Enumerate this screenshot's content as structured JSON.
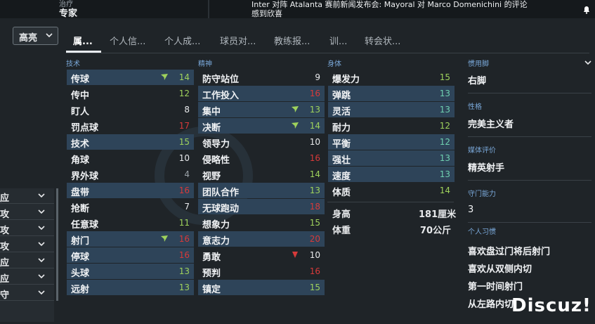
{
  "header": {
    "subtitle": "治疗",
    "role": "专家",
    "news": "Inter 对阵 Atalanta 赛前新闻发布会: Mayoral 对 Marco Domenichini 的评论感到欣喜"
  },
  "view_dropdown": {
    "label": "高亮"
  },
  "tabs": [
    "属...",
    "个人信...",
    "个人成...",
    "球员对...",
    "教练报...",
    "训...",
    "转会状..."
  ],
  "sections": {
    "technical": "技术",
    "mental": "精神",
    "physical": "身体"
  },
  "technical": [
    {
      "name": "传球",
      "value": "14",
      "color": "green",
      "mark": "up"
    },
    {
      "name": "传中",
      "value": "12",
      "color": "green"
    },
    {
      "name": "盯人",
      "value": "8",
      "color": "white"
    },
    {
      "name": "罚点球",
      "value": "17",
      "color": "red"
    },
    {
      "name": "技术",
      "value": "15",
      "color": "green"
    },
    {
      "name": "角球",
      "value": "10",
      "color": "white"
    },
    {
      "name": "界外球",
      "value": "4",
      "color": "grey"
    },
    {
      "name": "盘带",
      "value": "16",
      "color": "red"
    },
    {
      "name": "抢断",
      "value": "7",
      "color": "white"
    },
    {
      "name": "任意球",
      "value": "11",
      "color": "green"
    },
    {
      "name": "射门",
      "value": "16",
      "color": "red",
      "mark": "up"
    },
    {
      "name": "停球",
      "value": "16",
      "color": "red"
    },
    {
      "name": "头球",
      "value": "13",
      "color": "green"
    },
    {
      "name": "远射",
      "value": "13",
      "color": "green"
    }
  ],
  "mental": [
    {
      "name": "防守站位",
      "value": "9",
      "color": "white"
    },
    {
      "name": "工作投入",
      "value": "16",
      "color": "red"
    },
    {
      "name": "集中",
      "value": "13",
      "color": "green",
      "mark": "up"
    },
    {
      "name": "决断",
      "value": "14",
      "color": "green",
      "mark": "up"
    },
    {
      "name": "领导力",
      "value": "10",
      "color": "white"
    },
    {
      "name": "侵略性",
      "value": "16",
      "color": "red"
    },
    {
      "name": "视野",
      "value": "14",
      "color": "green"
    },
    {
      "name": "团队合作",
      "value": "13",
      "color": "green"
    },
    {
      "name": "无球跑动",
      "value": "18",
      "color": "red"
    },
    {
      "name": "想象力",
      "value": "15",
      "color": "green"
    },
    {
      "name": "意志力",
      "value": "20",
      "color": "red"
    },
    {
      "name": "勇敢",
      "value": "10",
      "color": "white",
      "mark": "down"
    },
    {
      "name": "预判",
      "value": "16",
      "color": "red"
    },
    {
      "name": "镇定",
      "value": "15",
      "color": "green"
    }
  ],
  "physical": [
    {
      "name": "爆发力",
      "value": "15",
      "color": "green"
    },
    {
      "name": "弹跳",
      "value": "13",
      "color": "teal"
    },
    {
      "name": "灵活",
      "value": "13",
      "color": "teal"
    },
    {
      "name": "耐力",
      "value": "12",
      "color": "green"
    },
    {
      "name": "平衡",
      "value": "12",
      "color": "teal"
    },
    {
      "name": "强壮",
      "value": "13",
      "color": "teal"
    },
    {
      "name": "速度",
      "value": "13",
      "color": "teal"
    },
    {
      "name": "体质",
      "value": "14",
      "color": "green"
    }
  ],
  "measures": [
    {
      "label": "身高",
      "value": "181厘米"
    },
    {
      "label": "体重",
      "value": "70公斤"
    }
  ],
  "right_panel": {
    "foot_title": "惯用脚",
    "foot_value": "右脚",
    "personality_title": "性格",
    "personality_value": "完美主义者",
    "media_title": "媒体评价",
    "media_value": "精英射手",
    "gk_title": "守门能力",
    "gk_value": "3",
    "habits_title": "个人习惯",
    "habits": [
      "喜欢盘过门将后射门",
      "喜欢从双侧内切",
      "第一时间射门",
      "从左路内切"
    ]
  },
  "left_panel": [
    "应",
    "攻",
    "攻",
    "攻",
    "应",
    "应",
    "守"
  ],
  "watermark": "Discuz!",
  "colors": {
    "green": "#9fd25c",
    "red": "#d63a3a",
    "white": "#e8eaec",
    "grey": "#9aa2a8",
    "teal": "#6fd0b0",
    "accent": "#79a7d8"
  }
}
